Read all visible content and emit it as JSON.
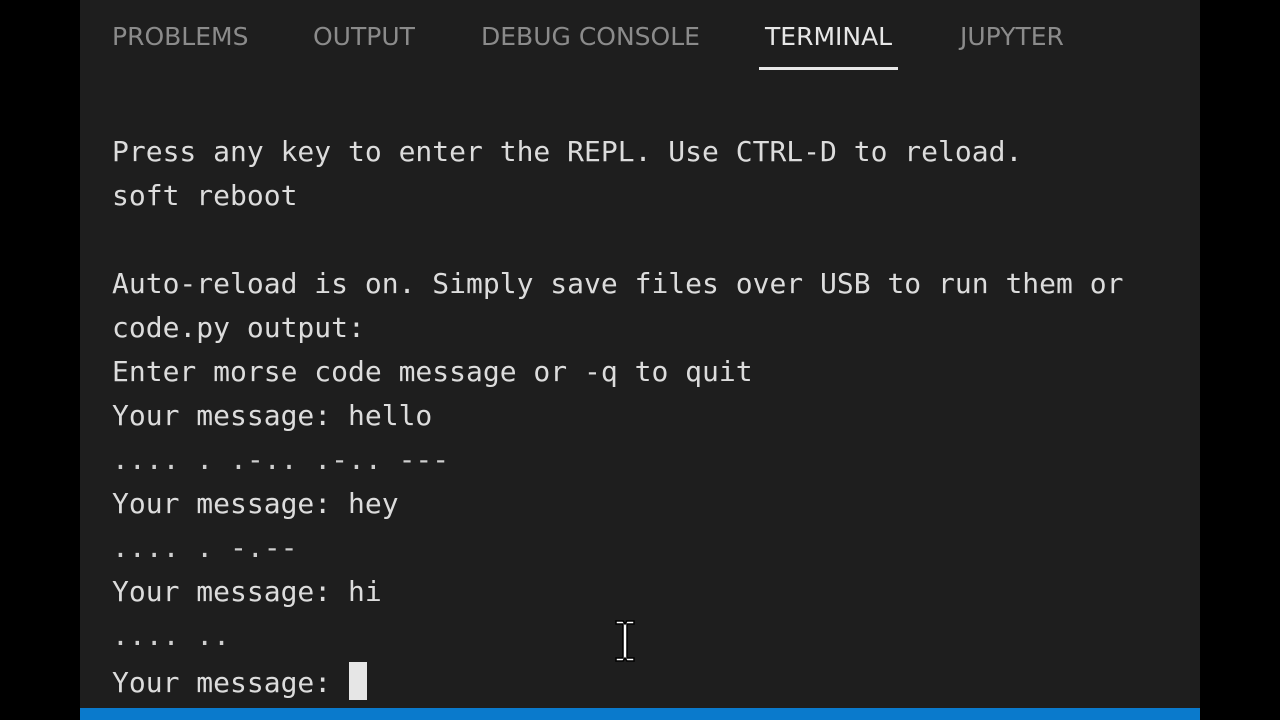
{
  "panel": {
    "tabs": [
      {
        "label": "PROBLEMS",
        "active": false
      },
      {
        "label": "OUTPUT",
        "active": false
      },
      {
        "label": "DEBUG CONSOLE",
        "active": false
      },
      {
        "label": "TERMINAL",
        "active": true
      },
      {
        "label": "JUPYTER",
        "active": false
      }
    ]
  },
  "terminal": {
    "lines": [
      "Press any key to enter the REPL. Use CTRL-D to reload.",
      "soft reboot",
      "",
      "Auto-reload is on. Simply save files over USB to run them or",
      "code.py output:",
      "Enter morse code message or -q to quit",
      "Your message: hello",
      ".... . .-.. .-.. ---",
      "Your message: hey",
      ".... . -.--",
      "Your message: hi",
      ".... ..",
      "Your message: "
    ]
  },
  "colors": {
    "background": "#1e1e1e",
    "active_tab": "#e7e7e7",
    "inactive_tab": "#8b8b8b",
    "status_bar": "#0a7acc"
  },
  "icons": {
    "mouse_pointer": "text-cursor-ibeam-icon"
  }
}
